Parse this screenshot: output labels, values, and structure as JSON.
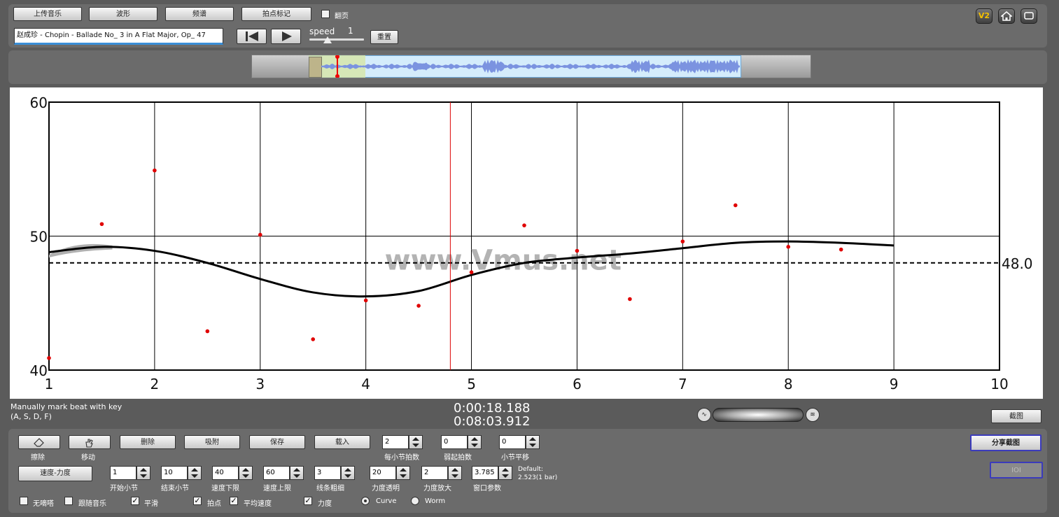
{
  "toolbar": {
    "upload": "上传音乐",
    "waveform": "波形",
    "spectrum": "频谱",
    "beat_mark": "拍点标记",
    "page_flip": "翻页",
    "track_name": "赵成珍 - Chopin - Ballade No_ 3 in A Flat Major, Op_ 47",
    "speed_label": "speed",
    "speed_value": "1",
    "reset": "重置",
    "v2": "V2"
  },
  "chart_data": {
    "type": "scatter",
    "xlim": [
      1,
      10
    ],
    "ylim": [
      40,
      60
    ],
    "xticks": [
      "1",
      "2",
      "3",
      "4",
      "5",
      "6",
      "7",
      "8",
      "9",
      "10"
    ],
    "yticks": [
      "40",
      "50",
      "60"
    ],
    "points": [
      [
        1,
        40.9
      ],
      [
        1.5,
        50.9
      ],
      [
        2,
        54.9
      ],
      [
        2.5,
        42.9
      ],
      [
        3,
        50.1
      ],
      [
        3.5,
        42.3
      ],
      [
        4,
        45.2
      ],
      [
        4.5,
        44.8
      ],
      [
        5,
        47.3
      ],
      [
        5.5,
        50.8
      ],
      [
        6,
        48.9
      ],
      [
        6.5,
        45.3
      ],
      [
        7,
        49.6
      ],
      [
        7.5,
        52.3
      ],
      [
        8,
        49.2
      ],
      [
        8.5,
        49.0
      ]
    ],
    "curve": [
      [
        1,
        48.8
      ],
      [
        1.5,
        49.2
      ],
      [
        2,
        48.9
      ],
      [
        2.5,
        48.0
      ],
      [
        3,
        46.8
      ],
      [
        3.5,
        45.8
      ],
      [
        4,
        45.5
      ],
      [
        4.5,
        45.9
      ],
      [
        5,
        47.1
      ],
      [
        5.5,
        48.0
      ],
      [
        6,
        48.4
      ],
      [
        6.5,
        48.7
      ],
      [
        7,
        49.1
      ],
      [
        7.5,
        49.5
      ],
      [
        8,
        49.6
      ],
      [
        8.5,
        49.5
      ],
      [
        9,
        49.3
      ]
    ],
    "average": 48.0,
    "average_label": "48.0",
    "cursor_x": 4.8,
    "watermark": "www.Vmus.net"
  },
  "status": {
    "hint_line1": "Manually mark beat with key",
    "hint_line2": "(A, S, D, F)",
    "time_current": "0:00:18.188",
    "time_total": "0:08:03.912",
    "screenshot": "截图"
  },
  "controls": {
    "erase": "擦除",
    "move": "移动",
    "delete": "删除",
    "snap": "吸附",
    "save": "保存",
    "load": "载入",
    "beats_per_bar_label": "每小节拍数",
    "beats_per_bar": "2",
    "pickup_label": "弱起拍数",
    "pickup": "0",
    "bar_shift_label": "小节平移",
    "bar_shift": "0",
    "share": "分享截图",
    "mode": "速度-力度",
    "start_bar_label": "开始小节",
    "start_bar": "1",
    "end_bar_label": "结束小节",
    "end_bar": "10",
    "tempo_min_label": "速度下限",
    "tempo_min": "40",
    "tempo_max_label": "速度上限",
    "tempo_max": "60",
    "line_width_label": "线条粗细",
    "line_width": "3",
    "dyn_alpha_label": "力度透明",
    "dyn_alpha": "20",
    "dyn_zoom_label": "力度放大",
    "dyn_zoom": "2",
    "window_label": "窗口参数",
    "window": "3.785",
    "default_line1": "Default:",
    "default_line2": "2.523(1 bar)",
    "extra_button": "IOI",
    "no_sound": "无嘀嗒",
    "follow_music": "跟随音乐",
    "smooth": "平滑",
    "beat_point": "拍点",
    "avg_tempo": "平均速度",
    "dynamics": "力度",
    "curve": "Curve",
    "worm": "Worm",
    "check_mark": "✓"
  }
}
